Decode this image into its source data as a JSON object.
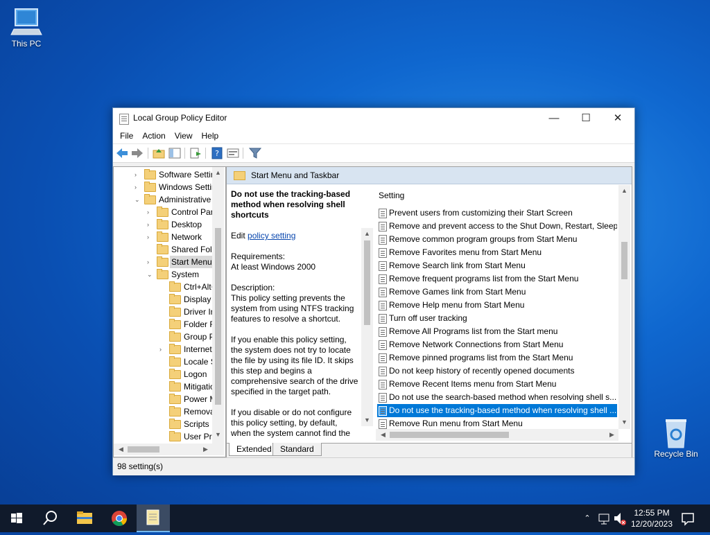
{
  "desktop": {
    "this_pc": "This PC",
    "recycle_bin": "Recycle Bin"
  },
  "window": {
    "title": "Local Group Policy Editor",
    "controls": {
      "minimize": "—",
      "maximize": "☐",
      "close": "✕"
    },
    "menu": [
      "File",
      "Action",
      "View",
      "Help"
    ],
    "status": "98 setting(s)"
  },
  "tree": {
    "items": [
      {
        "label": "Software Settings",
        "arrow": "›"
      },
      {
        "label": "Windows Settings",
        "arrow": "›"
      },
      {
        "label": "Administrative Templates",
        "arrow": "⌄"
      },
      {
        "label": "Control Panel",
        "arrow": "›"
      },
      {
        "label": "Desktop",
        "arrow": "›"
      },
      {
        "label": "Network",
        "arrow": "›"
      },
      {
        "label": "Shared Folders",
        "arrow": ""
      },
      {
        "label": "Start Menu and Taskbar",
        "arrow": "›"
      },
      {
        "label": "System",
        "arrow": "⌄"
      },
      {
        "label": "Ctrl+Alt+Del Options",
        "arrow": ""
      },
      {
        "label": "Display",
        "arrow": ""
      },
      {
        "label": "Driver Installation",
        "arrow": ""
      },
      {
        "label": "Folder Redirection",
        "arrow": ""
      },
      {
        "label": "Group Policy",
        "arrow": ""
      },
      {
        "label": "Internet Communication Management",
        "arrow": "›"
      },
      {
        "label": "Locale Services",
        "arrow": ""
      },
      {
        "label": "Logon",
        "arrow": ""
      },
      {
        "label": "Mitigation Options",
        "arrow": ""
      },
      {
        "label": "Power Management",
        "arrow": ""
      },
      {
        "label": "Removable Storage Access",
        "arrow": ""
      },
      {
        "label": "Scripts",
        "arrow": ""
      },
      {
        "label": "User Profiles",
        "arrow": ""
      }
    ]
  },
  "right": {
    "header": "Start Menu and Taskbar",
    "desc_title": "Do not use the tracking-based method when resolving shell shortcuts",
    "edit_prefix": "Edit ",
    "edit_link": "policy setting ",
    "req_label": "Requirements:",
    "req_value": "At least Windows 2000",
    "desc_label": "Description:",
    "desc_p1": "This policy setting prevents the system from using NTFS tracking features to resolve a shortcut.",
    "desc_p2": "If you enable this policy setting, the system does not try to locate the file by using its file ID. It skips this step and begins a comprehensive search of the drive specified in the target path.",
    "desc_p3": "If you disable or do not configure this policy setting, by default, when the system cannot find the",
    "column_header": "Setting",
    "settings": [
      "Prevent users from customizing their Start Screen",
      "Remove and prevent access to the Shut Down, Restart, Sleep...",
      "Remove common program groups from Start Menu",
      "Remove Favorites menu from Start Menu",
      "Remove Search link from Start Menu",
      "Remove frequent programs list from the Start Menu",
      "Remove Games link from Start Menu",
      "Remove Help menu from Start Menu",
      "Turn off user tracking",
      "Remove All Programs list from the Start menu",
      "Remove Network Connections from Start Menu",
      "Remove pinned programs list from the Start Menu",
      "Do not keep history of recently opened documents",
      "Remove Recent Items menu from Start Menu",
      "Do not use the search-based method when resolving shell s...",
      "Do not use the tracking-based method when resolving shell ...",
      "Remove Run menu from Start Menu"
    ],
    "selected_index": 15,
    "tabs": [
      "Extended",
      "Standard"
    ]
  },
  "taskbar": {
    "time": "12:55 PM",
    "date": "12/20/2023"
  },
  "colors": {
    "selection": "#0078d7",
    "taskbar": "#101a2b",
    "header_band": "#d8e4f1"
  }
}
